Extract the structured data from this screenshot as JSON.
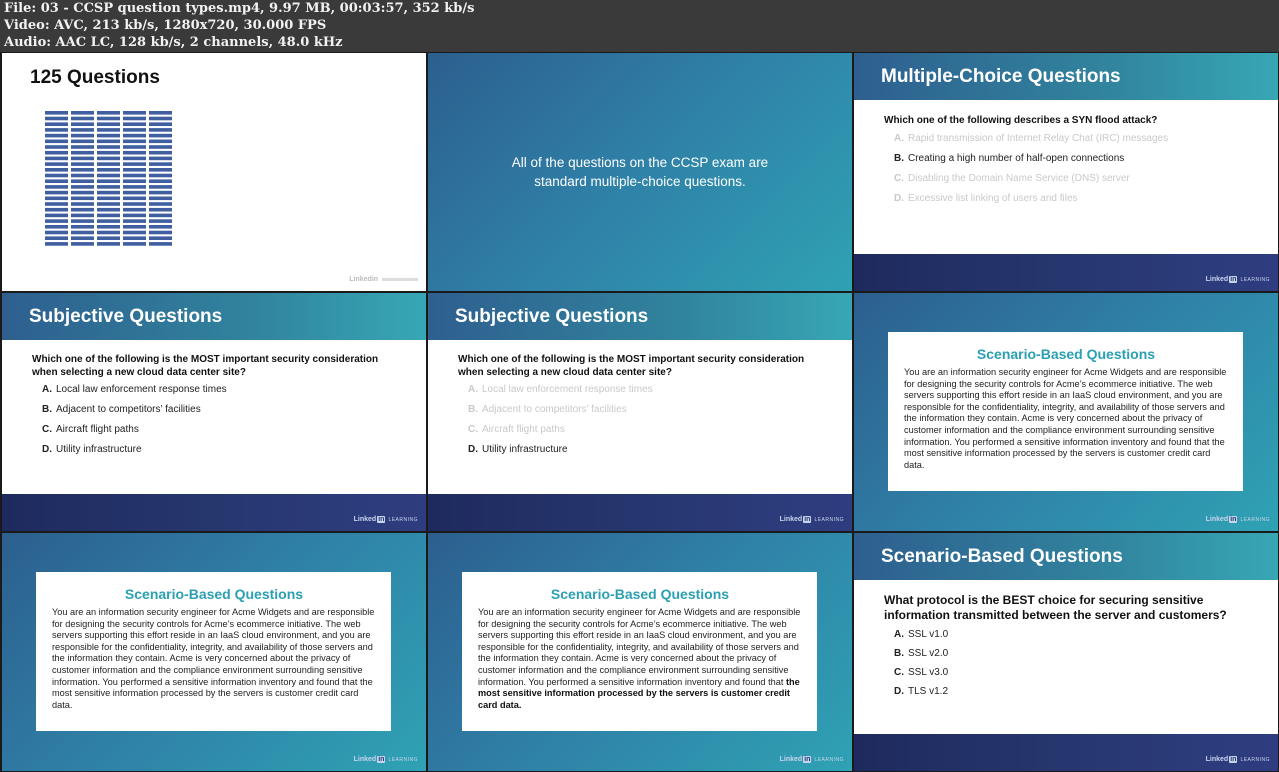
{
  "meta": {
    "file_line": "File: 03 - CCSP question types.mp4, 9.97 MB, 00:03:57, 352 kb/s",
    "video_line": "Video: AVC, 213 kb/s, 1280x720, 30.000 FPS",
    "audio_line": "Audio: AAC LC, 128 kb/s, 2 channels, 48.0 kHz"
  },
  "brand": {
    "linked": "Linked",
    "in": "in",
    "learning": "LEARNING"
  },
  "t1": {
    "title": "125 Questions",
    "bar_rows": 24,
    "bar_cols": 5
  },
  "t2": {
    "line1": "All of the questions on the CCSP exam are",
    "line2": "standard multiple-choice questions."
  },
  "t3": {
    "title": "Multiple-Choice Questions",
    "question": "Which one of the following describes a SYN flood attack?",
    "options": [
      {
        "letter": "A.",
        "text": "Rapid transmission of Internet Relay Chat (IRC) messages",
        "dim": true
      },
      {
        "letter": "B.",
        "text": "Creating a high number of half-open connections",
        "dim": false
      },
      {
        "letter": "C.",
        "text": "Disabling the Domain Name Service (DNS) server",
        "dim": true
      },
      {
        "letter": "D.",
        "text": "Excessive list linking of users and files",
        "dim": true
      }
    ]
  },
  "t4": {
    "title": "Subjective Questions",
    "question_line1": "Which one of the following is the MOST important security consideration",
    "question_line2": "when selecting a new cloud data center site?",
    "options": [
      {
        "letter": "A.",
        "text": "Local law enforcement response times"
      },
      {
        "letter": "B.",
        "text": "Adjacent to competitors’ facilities"
      },
      {
        "letter": "C.",
        "text": "Aircraft flight paths"
      },
      {
        "letter": "D.",
        "text": "Utility infrastructure"
      }
    ]
  },
  "t5": {
    "title": "Subjective Questions",
    "question_line1": "Which one of the following is the MOST important security consideration",
    "question_line2": "when selecting a new cloud data center site?",
    "options": [
      {
        "letter": "A.",
        "text": "Local law enforcement response times",
        "dim": true
      },
      {
        "letter": "B.",
        "text": "Adjacent to competitors’ facilities",
        "dim": true
      },
      {
        "letter": "C.",
        "text": "Aircraft flight paths",
        "dim": true
      },
      {
        "letter": "D.",
        "text": "Utility infrastructure",
        "dim": false
      }
    ]
  },
  "scenario": {
    "title": "Scenario-Based Questions",
    "body": "You are an information security engineer for Acme Widgets and are responsible for designing the security controls for Acme’s ecommerce initiative. The web servers supporting this effort reside in an IaaS cloud environment, and you are responsible for the confidentiality, integrity, and availability of those servers and the information they contain. Acme is very concerned about the privacy of customer information and the compliance environment surrounding sensitive information. You performed a sensitive information inventory and found that the most sensitive information processed by the servers is customer credit card data.",
    "body_prefix": "You are an information security engineer for Acme Widgets and are responsible for designing the security controls for Acme’s ecommerce initiative. The web servers supporting this effort reside in an IaaS cloud environment, and you are responsible for the confidentiality, integrity, and availability of those servers and the information they contain. Acme is very concerned about the privacy of customer information and the compliance environment surrounding sensitive information. You performed a sensitive information inventory and found that ",
    "body_bold": "the most sensitive information processed by the servers is customer credit card data."
  },
  "t9": {
    "title": "Scenario-Based Questions",
    "question_line1": "What protocol is the BEST choice for securing sensitive",
    "question_line2": "information transmitted between the server and customers?",
    "options": [
      {
        "letter": "A.",
        "text": "SSL v1.0"
      },
      {
        "letter": "B.",
        "text": "SSL v2.0"
      },
      {
        "letter": "C.",
        "text": "SSL v3.0"
      },
      {
        "letter": "D.",
        "text": "TLS v1.2"
      }
    ]
  }
}
